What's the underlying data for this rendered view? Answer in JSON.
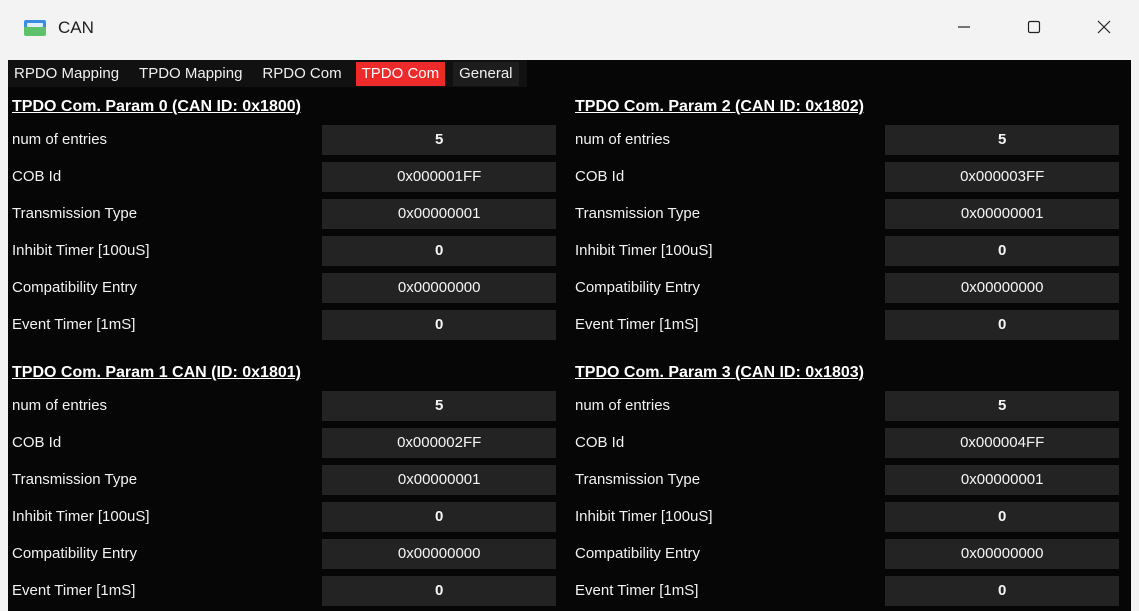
{
  "window": {
    "title": "CAN",
    "controls": {
      "minimize_icon": "minimize-icon",
      "maximize_icon": "maximize-icon",
      "close_icon": "close-icon"
    }
  },
  "tabs": [
    {
      "label": "RPDO Mapping",
      "active": false
    },
    {
      "label": "TPDO Mapping",
      "active": false
    },
    {
      "label": "RPDO Com",
      "active": false
    },
    {
      "label": "TPDO Com",
      "active": true
    },
    {
      "label": "General",
      "active": false
    }
  ],
  "accent_color": "#ef2a2a",
  "groups": [
    {
      "title": "TPDO Com. Param 0 (CAN ID: 0x1800)",
      "rows": [
        {
          "label": "num of entries",
          "value": "5"
        },
        {
          "label": "COB Id",
          "value": "0x000001FF"
        },
        {
          "label": "Transmission Type",
          "value": "0x00000001"
        },
        {
          "label": "Inhibit Timer [100uS]",
          "value": "0"
        },
        {
          "label": "Compatibility Entry",
          "value": "0x00000000"
        },
        {
          "label": "Event Timer [1mS]",
          "value": "0"
        }
      ]
    },
    {
      "title": "TPDO Com. Param 2 (CAN ID: 0x1802)",
      "rows": [
        {
          "label": "num of entries",
          "value": "5"
        },
        {
          "label": "COB Id",
          "value": "0x000003FF"
        },
        {
          "label": "Transmission Type",
          "value": "0x00000001"
        },
        {
          "label": "Inhibit Timer [100uS]",
          "value": "0"
        },
        {
          "label": "Compatibility Entry",
          "value": "0x00000000"
        },
        {
          "label": "Event Timer [1mS]",
          "value": "0"
        }
      ]
    },
    {
      "title": "TPDO Com. Param 1 CAN (ID: 0x1801)",
      "rows": [
        {
          "label": "num of entries",
          "value": "5"
        },
        {
          "label": "COB Id",
          "value": "0x000002FF"
        },
        {
          "label": "Transmission Type",
          "value": "0x00000001"
        },
        {
          "label": "Inhibit Timer [100uS]",
          "value": "0"
        },
        {
          "label": "Compatibility Entry",
          "value": "0x00000000"
        },
        {
          "label": "Event Timer [1mS]",
          "value": "0"
        }
      ]
    },
    {
      "title": "TPDO Com. Param 3 (CAN ID: 0x1803)",
      "rows": [
        {
          "label": "num of entries",
          "value": "5"
        },
        {
          "label": "COB Id",
          "value": "0x000004FF"
        },
        {
          "label": "Transmission Type",
          "value": "0x00000001"
        },
        {
          "label": "Inhibit Timer [100uS]",
          "value": "0"
        },
        {
          "label": "Compatibility Entry",
          "value": "0x00000000"
        },
        {
          "label": "Event Timer [1mS]",
          "value": "0"
        }
      ]
    }
  ]
}
